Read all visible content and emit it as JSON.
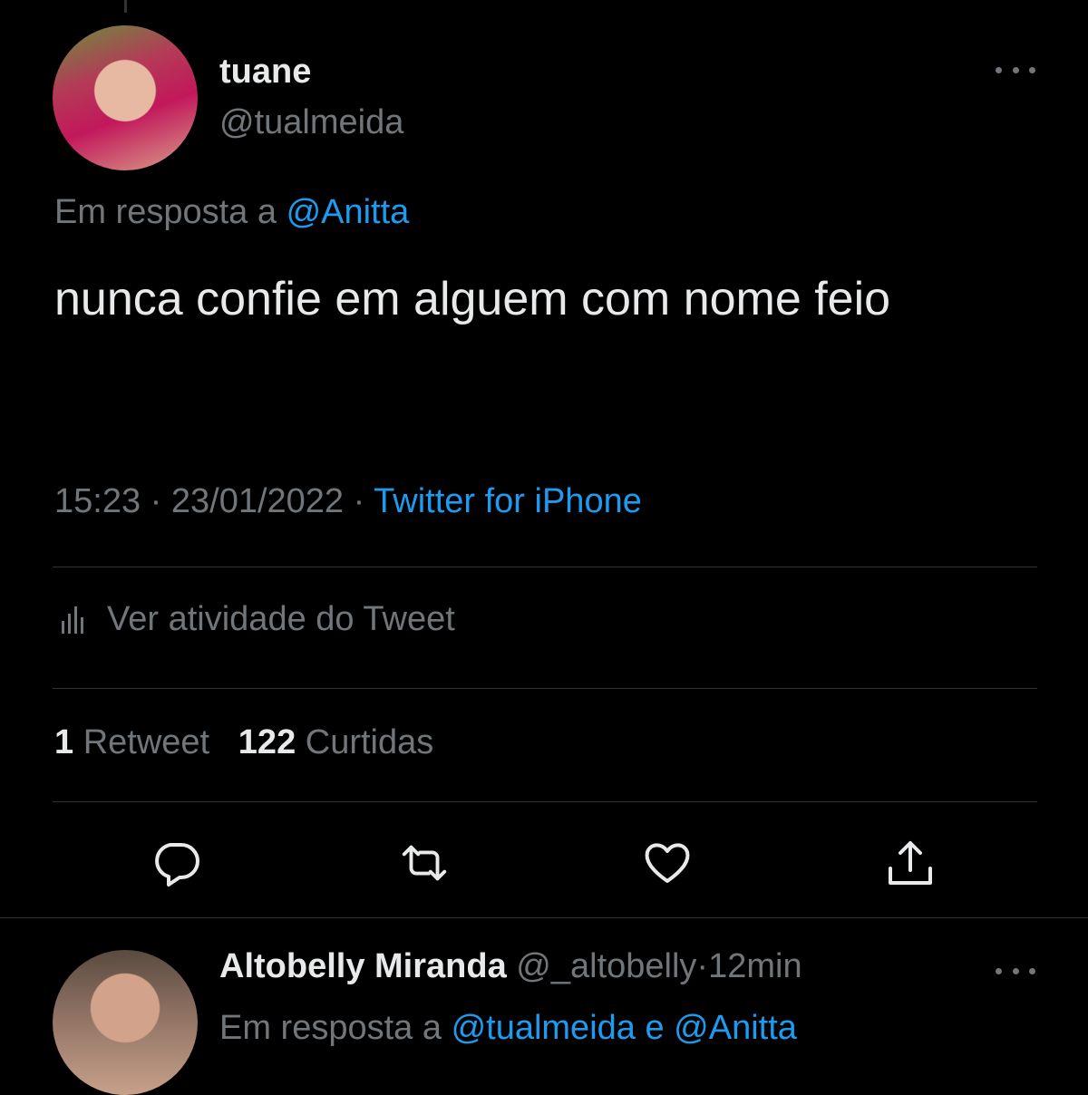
{
  "tweet": {
    "author": {
      "name": "tuane",
      "handle": "@tualmeida"
    },
    "reply_prefix": "Em resposta a",
    "reply_to": "@Anitta",
    "text": "nunca confie em alguem com nome feio",
    "time": "15:23",
    "date": "23/01/2022",
    "source": "Twitter for iPhone",
    "separator": "·",
    "activity_label": "Ver atividade do Tweet",
    "stats": {
      "retweets_count": "1",
      "retweets_label": "Retweet",
      "likes_count": "122",
      "likes_label": "Curtidas"
    },
    "actions": [
      "reply-icon",
      "retweet-icon",
      "like-icon",
      "share-icon"
    ]
  },
  "reply": {
    "author": {
      "name": "Altobelly Miranda",
      "handle": "@_altobelly"
    },
    "age": "12min",
    "reply_prefix": "Em resposta a",
    "reply_to_1": "@tualmeida",
    "conjunction": "e",
    "reply_to_2": "@Anitta"
  },
  "colors": {
    "background": "#000000",
    "text": "#e7e9ea",
    "muted": "#71767b",
    "accent": "#1d9bf0",
    "divider": "#2f3336"
  }
}
